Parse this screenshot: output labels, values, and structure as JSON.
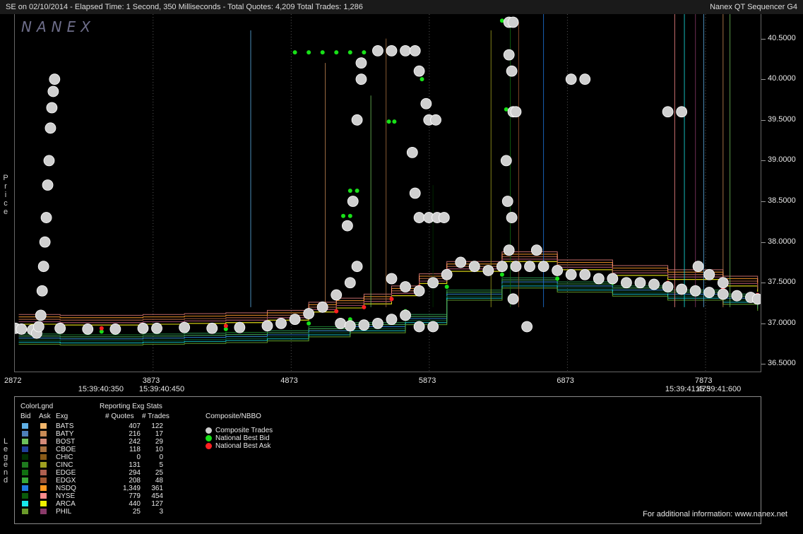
{
  "header": {
    "left": "SE on 02/10/2014  -  Elapsed Time: 1 Second, 350 Milliseconds  -  Total Quotes: 4,209  Total Trades: 1,286",
    "right": "Nanex QT Sequencer G4",
    "logo": "NANEX"
  },
  "chart_data": {
    "type": "scatter",
    "ylabel": "Price",
    "ylim": [
      36.4,
      40.8
    ],
    "xlim": [
      2872,
      8272
    ],
    "y_ticks": [
      "40.5000",
      "40.0000",
      "39.5000",
      "39.0000",
      "38.5000",
      "38.0000",
      "37.5000",
      "37.0000",
      "36.5000"
    ],
    "y_tick_values": [
      40.5,
      40.0,
      39.5,
      39.0,
      38.5,
      38.0,
      37.5,
      37.0,
      36.5
    ],
    "x_ticks": [
      "2872",
      "3873",
      "4873",
      "5873",
      "6873",
      "7873"
    ],
    "x_tick_values": [
      2872,
      3873,
      4873,
      5873,
      6873,
      7873
    ],
    "x_time_labels": [
      {
        "label": "15:39:40:350",
        "x": 3500
      },
      {
        "label": "15:39:40:450",
        "x": 3940
      },
      {
        "label": "15:39:41:475",
        "x": 7750
      },
      {
        "label": "15:39:41:600",
        "x": 8230
      }
    ],
    "series": [
      {
        "name": "Composite Trades",
        "color": "#cfcfcf",
        "points": [
          [
            2876,
            36.94
          ],
          [
            2920,
            36.93
          ],
          [
            3000,
            36.92
          ],
          [
            3030,
            36.88
          ],
          [
            3045,
            36.96
          ],
          [
            3060,
            37.1
          ],
          [
            3070,
            37.4
          ],
          [
            3080,
            37.7
          ],
          [
            3090,
            38.0
          ],
          [
            3100,
            38.3
          ],
          [
            3110,
            38.7
          ],
          [
            3120,
            39.0
          ],
          [
            3130,
            39.4
          ],
          [
            3140,
            39.65
          ],
          [
            3150,
            39.85
          ],
          [
            3160,
            40.0
          ],
          [
            3200,
            36.94
          ],
          [
            3400,
            36.93
          ],
          [
            3600,
            36.93
          ],
          [
            3800,
            36.94
          ],
          [
            3900,
            36.94
          ],
          [
            4100,
            36.95
          ],
          [
            4300,
            36.94
          ],
          [
            4500,
            36.95
          ],
          [
            4700,
            36.97
          ],
          [
            4800,
            37.0
          ],
          [
            4900,
            37.05
          ],
          [
            5000,
            37.12
          ],
          [
            5100,
            37.2
          ],
          [
            5200,
            37.35
          ],
          [
            5300,
            37.5
          ],
          [
            5350,
            37.7
          ],
          [
            5230,
            37.0
          ],
          [
            5300,
            36.97
          ],
          [
            5400,
            36.98
          ],
          [
            5500,
            37.0
          ],
          [
            5600,
            37.05
          ],
          [
            5700,
            37.1
          ],
          [
            5800,
            36.96
          ],
          [
            5900,
            36.96
          ],
          [
            5280,
            38.2
          ],
          [
            5320,
            38.5
          ],
          [
            5350,
            39.5
          ],
          [
            5380,
            40.0
          ],
          [
            5380,
            40.2
          ],
          [
            5500,
            40.35
          ],
          [
            5600,
            40.35
          ],
          [
            5700,
            40.35
          ],
          [
            5770,
            40.35
          ],
          [
            5800,
            40.1
          ],
          [
            5850,
            39.7
          ],
          [
            5870,
            39.5
          ],
          [
            5920,
            39.5
          ],
          [
            5750,
            39.1
          ],
          [
            5770,
            38.6
          ],
          [
            5800,
            38.3
          ],
          [
            5870,
            38.3
          ],
          [
            5930,
            38.3
          ],
          [
            5980,
            38.3
          ],
          [
            5600,
            37.55
          ],
          [
            5700,
            37.45
          ],
          [
            5800,
            37.4
          ],
          [
            5900,
            37.5
          ],
          [
            6000,
            37.6
          ],
          [
            6100,
            37.75
          ],
          [
            6200,
            37.7
          ],
          [
            6300,
            37.65
          ],
          [
            6400,
            37.7
          ],
          [
            6500,
            37.7
          ],
          [
            6600,
            37.7
          ],
          [
            6700,
            37.7
          ],
          [
            6800,
            37.65
          ],
          [
            6900,
            37.6
          ],
          [
            7000,
            37.6
          ],
          [
            7100,
            37.55
          ],
          [
            7200,
            37.55
          ],
          [
            7300,
            37.5
          ],
          [
            7400,
            37.5
          ],
          [
            7500,
            37.48
          ],
          [
            7600,
            37.45
          ],
          [
            7700,
            37.42
          ],
          [
            7800,
            37.4
          ],
          [
            7900,
            37.38
          ],
          [
            8000,
            37.36
          ],
          [
            8100,
            37.34
          ],
          [
            8200,
            37.32
          ],
          [
            8250,
            37.3
          ],
          [
            6450,
            40.7
          ],
          [
            6480,
            40.7
          ],
          [
            6450,
            40.3
          ],
          [
            6470,
            40.1
          ],
          [
            6480,
            39.6
          ],
          [
            6500,
            39.6
          ],
          [
            6430,
            39.0
          ],
          [
            6440,
            38.5
          ],
          [
            6470,
            38.3
          ],
          [
            6450,
            37.9
          ],
          [
            6480,
            37.3
          ],
          [
            6580,
            36.96
          ],
          [
            6650,
            37.9
          ],
          [
            6900,
            40.0
          ],
          [
            7000,
            40.0
          ],
          [
            7600,
            39.6
          ],
          [
            7700,
            39.6
          ],
          [
            7820,
            37.7
          ],
          [
            7900,
            37.6
          ],
          [
            8000,
            37.5
          ]
        ]
      },
      {
        "name": "National Best Bid",
        "color": "#18e018",
        "points": [
          [
            4900,
            40.33
          ],
          [
            5000,
            40.33
          ],
          [
            5100,
            40.33
          ],
          [
            5200,
            40.33
          ],
          [
            5300,
            40.33
          ],
          [
            5400,
            40.33
          ],
          [
            5300,
            38.63
          ],
          [
            5350,
            38.63
          ],
          [
            5250,
            38.32
          ],
          [
            5300,
            38.32
          ],
          [
            5580,
            39.48
          ],
          [
            5620,
            39.48
          ],
          [
            5820,
            40.0
          ],
          [
            6400,
            40.72
          ],
          [
            6430,
            39.63
          ],
          [
            2900,
            36.91
          ],
          [
            3200,
            36.9
          ],
          [
            3500,
            36.9
          ],
          [
            3800,
            36.91
          ],
          [
            4100,
            36.92
          ],
          [
            4400,
            36.93
          ],
          [
            4700,
            36.95
          ],
          [
            5000,
            37.0
          ],
          [
            5300,
            37.05
          ],
          [
            5700,
            37.15
          ],
          [
            6000,
            37.45
          ],
          [
            6400,
            37.6
          ],
          [
            6800,
            37.55
          ],
          [
            7200,
            37.5
          ],
          [
            7600,
            37.45
          ],
          [
            8000,
            37.4
          ],
          [
            8250,
            37.32
          ]
        ]
      },
      {
        "name": "National Best Ask",
        "color": "#ff2020",
        "points": [
          [
            2900,
            36.95
          ],
          [
            3200,
            36.94
          ],
          [
            3500,
            36.94
          ],
          [
            3800,
            36.95
          ],
          [
            4100,
            36.96
          ],
          [
            4400,
            36.97
          ],
          [
            4700,
            37.0
          ],
          [
            5000,
            37.1
          ],
          [
            5200,
            37.15
          ],
          [
            5400,
            37.2
          ],
          [
            5600,
            37.3
          ],
          [
            5800,
            37.45
          ],
          [
            6000,
            37.6
          ],
          [
            6400,
            37.72
          ],
          [
            6800,
            37.62
          ],
          [
            7200,
            37.55
          ],
          [
            7600,
            37.5
          ],
          [
            8000,
            37.42
          ],
          [
            8250,
            37.35
          ]
        ]
      }
    ]
  },
  "legend": {
    "side_label": "Legend",
    "colorlegend_title": "ColorLgnd",
    "col_bid": "Bid",
    "col_ask": "Ask",
    "col_exg": "Exg",
    "stats_title": "Reporting Exg Stats",
    "col_quotes": "# Quotes",
    "col_trades": "# Trades",
    "composite_title": "Composite/NBBO",
    "rows": [
      {
        "exg": "BATS",
        "bid": "#5fb0e6",
        "ask": "#f2b66b",
        "quotes": "407",
        "trades": "122"
      },
      {
        "exg": "BATY",
        "bid": "#4d7fb8",
        "ask": "#c98a55",
        "quotes": "216",
        "trades": "17"
      },
      {
        "exg": "BOST",
        "bid": "#6dc05c",
        "ask": "#d48a78",
        "quotes": "242",
        "trades": "29"
      },
      {
        "exg": "CBOE",
        "bid": "#203f9a",
        "ask": "#a8703f",
        "quotes": "118",
        "trades": "10"
      },
      {
        "exg": "CHIC",
        "bid": "#003000",
        "ask": "#8a5b17",
        "quotes": "0",
        "trades": "0"
      },
      {
        "exg": "CINC",
        "bid": "#1e7a1e",
        "ask": "#a0a020",
        "quotes": "131",
        "trades": "5"
      },
      {
        "exg": "EDGE",
        "bid": "#107010",
        "ask": "#b06050",
        "quotes": "294",
        "trades": "25"
      },
      {
        "exg": "EDGX",
        "bid": "#38a838",
        "ask": "#a05530",
        "quotes": "208",
        "trades": "48"
      },
      {
        "exg": "NSDQ",
        "bid": "#1f78e0",
        "ask": "#ff9920",
        "quotes": "1,349",
        "trades": "361"
      },
      {
        "exg": "NYSE",
        "bid": "#0a5a0a",
        "ask": "#ff8c8c",
        "quotes": "779",
        "trades": "454"
      },
      {
        "exg": "ARCA",
        "bid": "#18e8e8",
        "ask": "#f0f000",
        "quotes": "440",
        "trades": "127"
      },
      {
        "exg": "PHIL",
        "bid": "#6a9a2a",
        "ask": "#8a3a6a",
        "quotes": "25",
        "trades": "3"
      }
    ],
    "composite": [
      {
        "label": "Composite Trades",
        "color": "#cfcfcf"
      },
      {
        "label": "National Best Bid",
        "color": "#18e018"
      },
      {
        "label": "National Best Ask",
        "color": "#ff2020"
      }
    ]
  },
  "footer": "For additional information: www.nanex.net"
}
